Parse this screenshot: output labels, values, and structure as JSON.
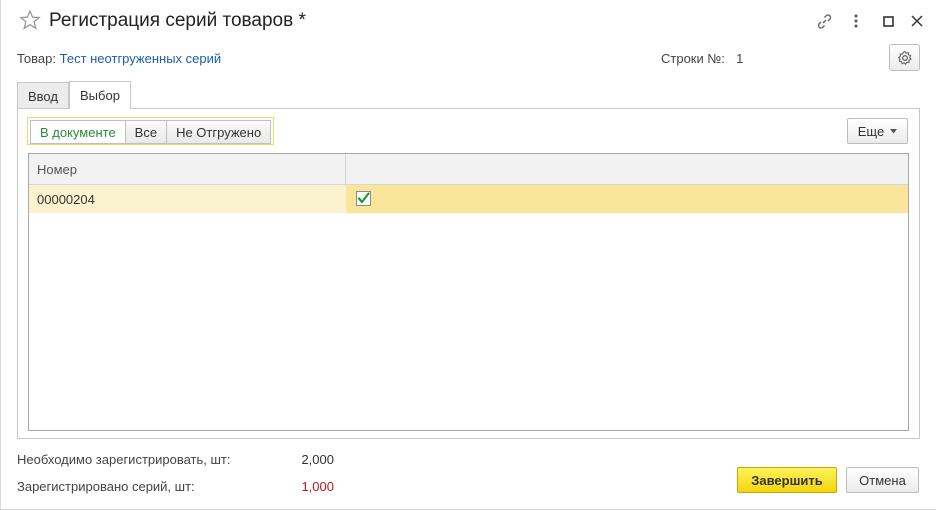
{
  "window": {
    "title": "Регистрация серий товаров *"
  },
  "info": {
    "product_label": "Товар:",
    "product_value": "Тест неотгруженных серий",
    "rows_label": "Строки №:",
    "rows_value": "1"
  },
  "tabs": [
    {
      "label": "Ввод",
      "active": false
    },
    {
      "label": "Выбор",
      "active": true
    }
  ],
  "filters": [
    {
      "label": "В документе",
      "active": true
    },
    {
      "label": "Все",
      "active": false
    },
    {
      "label": "Не Отгружено",
      "active": false
    }
  ],
  "more_button": {
    "label": "Еще"
  },
  "grid": {
    "columns": [
      "Номер",
      ""
    ],
    "rows": [
      {
        "number": "00000204",
        "checked": true
      }
    ]
  },
  "summary": {
    "required_label": "Необходимо зарегистрировать, шт:",
    "required_value": "2,000",
    "registered_label": "Зарегистрировано серий, шт:",
    "registered_value": "1,000"
  },
  "buttons": {
    "finish": "Завершить",
    "cancel": "Отмена"
  },
  "colors": {
    "accent_link": "#1c5ea8",
    "active_filter": "#2a8a3c",
    "warning_value": "#c0161d",
    "primary_button": "#f3d50c",
    "selected_row": "#fbe59b"
  }
}
